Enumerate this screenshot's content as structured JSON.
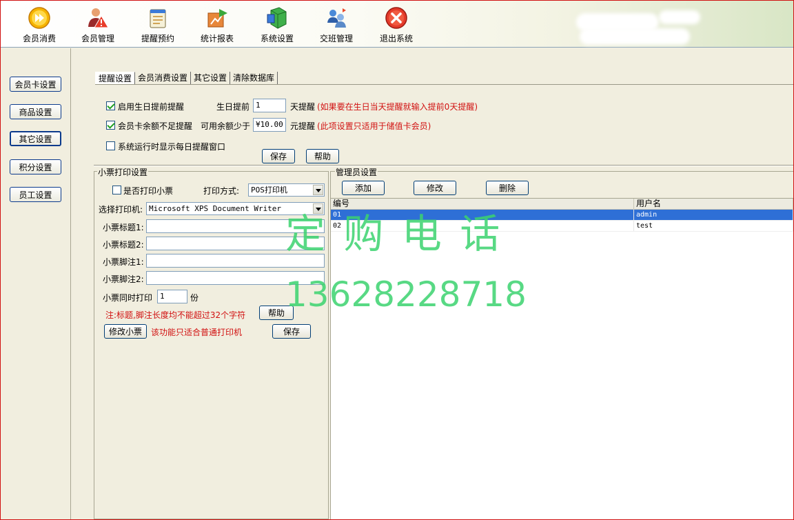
{
  "toolbar": {
    "items": [
      {
        "label": "会员消费",
        "icon": "play-circle-icon"
      },
      {
        "label": "会员管理",
        "icon": "member-warning-icon"
      },
      {
        "label": "提醒预约",
        "icon": "notepad-icon"
      },
      {
        "label": "统计报表",
        "icon": "chart-arrow-icon"
      },
      {
        "label": "系统设置",
        "icon": "settings-cube-icon"
      },
      {
        "label": "交班管理",
        "icon": "shift-exchange-icon"
      },
      {
        "label": "退出系统",
        "icon": "close-circle-icon"
      }
    ]
  },
  "sidebar": {
    "items": [
      "会员卡设置",
      "商品设置",
      "其它设置",
      "积分设置",
      "员工设置"
    ],
    "active": "其它设置"
  },
  "tabs": [
    "提醒设置",
    "会员消费设置",
    "其它设置",
    "清除数据库"
  ],
  "reminder": {
    "birthday_label": "启用生日提前提醒",
    "birthday_days_label": "生日提前",
    "birthday_days_value": "1",
    "birthday_unit": "天提醒",
    "birthday_note": "(如果要在生日当天提醒就输入提前0天提醒)",
    "balance_label": "会员卡余额不足提醒",
    "balance_threshold_label": "可用余额少于",
    "balance_value": "¥10.00",
    "balance_unit": "元提醒",
    "balance_note": "(此项设置只适用于储值卡会员)",
    "daily_label": "系统运行时显示每日提醒窗口",
    "save": "保存",
    "help": "帮助"
  },
  "receipt": {
    "title": "小票打印设置",
    "print_label": "是否打印小票",
    "mode_label": "打印方式:",
    "mode_value": "POS打印机",
    "printer_label": "选择打印机:",
    "printer_value": "Microsoft XPS Document Writer",
    "title1_label": "小票标题1:",
    "title2_label": "小票标题2:",
    "foot1_label": "小票脚注1:",
    "foot2_label": "小票脚注2:",
    "copies_label": "小票同时打印",
    "copies_value": "1",
    "copies_unit": "份",
    "note": "注:标题,脚注长度均不能超过32个字符",
    "help": "帮助",
    "edit": "修改小票",
    "edit_note": "该功能只适合普通打印机",
    "save": "保存"
  },
  "admin": {
    "title": "管理员设置",
    "add": "添加",
    "edit": "修改",
    "delete": "删除",
    "columns": [
      "编号",
      "用户名"
    ],
    "rows": [
      [
        "01",
        "admin"
      ],
      [
        "02",
        "test"
      ]
    ]
  },
  "watermark": {
    "line1": "定 购 电 话",
    "line2": "13628228718"
  }
}
